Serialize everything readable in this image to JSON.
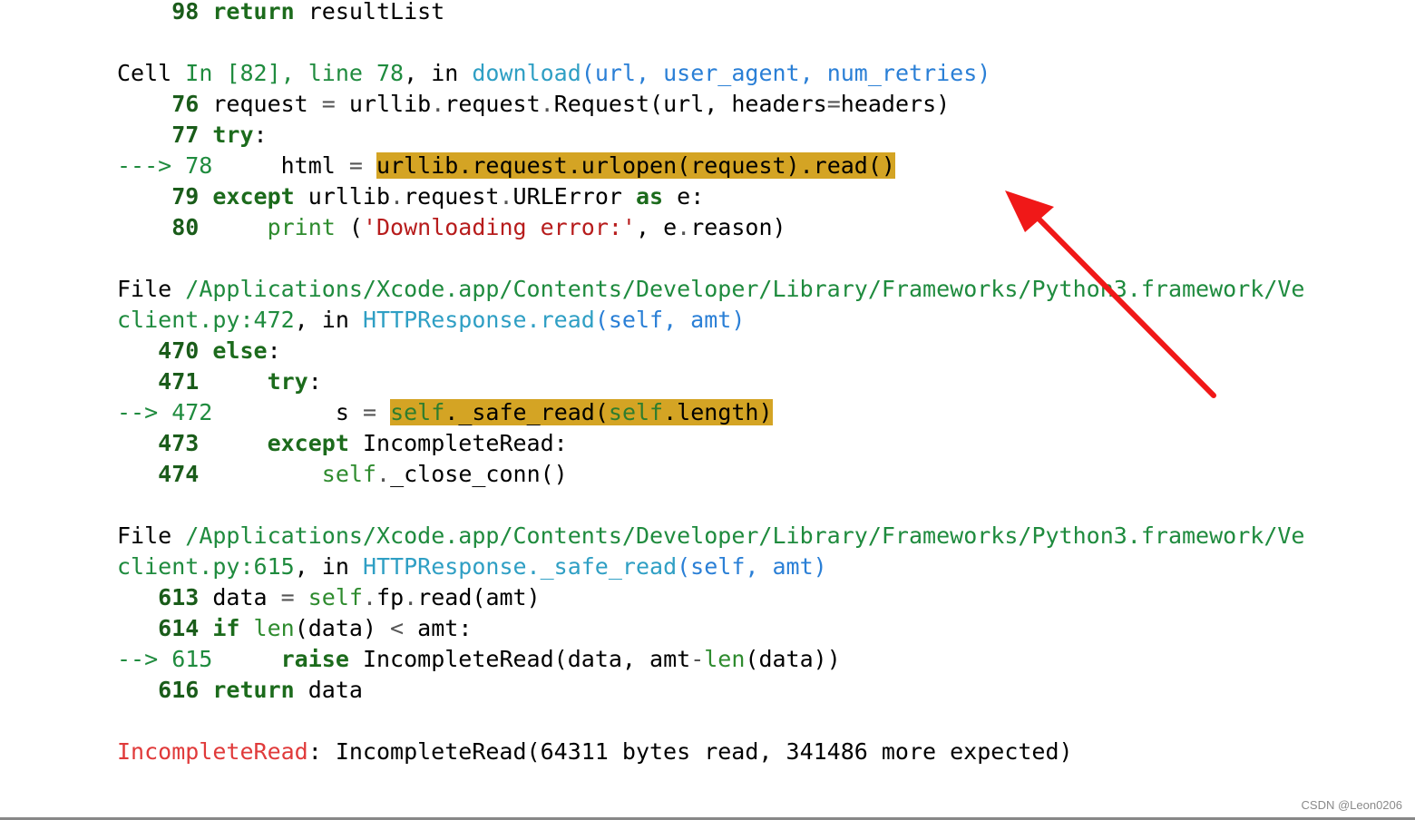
{
  "lines": [
    [
      {
        "t": "    98 ",
        "c": "num"
      },
      {
        "t": "return",
        "c": "kw"
      },
      {
        "t": " resultList",
        "c": "plain"
      }
    ],
    [],
    [
      {
        "t": "Cell ",
        "c": "plain"
      },
      {
        "t": "In [82], line 78",
        "c": "file"
      },
      {
        "t": ", in ",
        "c": "plain"
      },
      {
        "t": "download",
        "c": "func"
      },
      {
        "t": "(url, user_agent, num_retries)",
        "c": "arg"
      }
    ],
    [
      {
        "t": "    76 ",
        "c": "num"
      },
      {
        "t": "request ",
        "c": "plain"
      },
      {
        "t": "=",
        "c": "op"
      },
      {
        "t": " urllib",
        "c": "plain"
      },
      {
        "t": ".",
        "c": "op"
      },
      {
        "t": "request",
        "c": "plain"
      },
      {
        "t": ".",
        "c": "op"
      },
      {
        "t": "Request(url, headers",
        "c": "plain"
      },
      {
        "t": "=",
        "c": "op"
      },
      {
        "t": "headers)",
        "c": "plain"
      }
    ],
    [
      {
        "t": "    77 ",
        "c": "num"
      },
      {
        "t": "try",
        "c": "kw"
      },
      {
        "t": ":",
        "c": "plain"
      }
    ],
    [
      {
        "t": "---> 78     ",
        "c": "file"
      },
      {
        "t": "html ",
        "c": "plain"
      },
      {
        "t": "=",
        "c": "op"
      },
      {
        "t": " ",
        "c": "plain"
      },
      {
        "t": "urllib.request.urlopen(request).read()",
        "c": "hl"
      }
    ],
    [
      {
        "t": "    79 ",
        "c": "num"
      },
      {
        "t": "except",
        "c": "kw"
      },
      {
        "t": " urllib",
        "c": "plain"
      },
      {
        "t": ".",
        "c": "op"
      },
      {
        "t": "request",
        "c": "plain"
      },
      {
        "t": ".",
        "c": "op"
      },
      {
        "t": "URLError ",
        "c": "plain"
      },
      {
        "t": "as",
        "c": "kw"
      },
      {
        "t": " e:",
        "c": "plain"
      }
    ],
    [
      {
        "t": "    80     ",
        "c": "num"
      },
      {
        "t": "print",
        "c": "builtin"
      },
      {
        "t": " (",
        "c": "plain"
      },
      {
        "t": "'Downloading error:'",
        "c": "str"
      },
      {
        "t": ", e",
        "c": "plain"
      },
      {
        "t": ".",
        "c": "op"
      },
      {
        "t": "reason)",
        "c": "plain"
      }
    ],
    [],
    [
      {
        "t": "File ",
        "c": "plain"
      },
      {
        "t": "/Applications/Xcode.app/Contents/Developer/Library/Frameworks/Python3.framework/Ve",
        "c": "file"
      }
    ],
    [
      {
        "t": "client.py:472",
        "c": "file"
      },
      {
        "t": ", in ",
        "c": "plain"
      },
      {
        "t": "HTTPResponse.read",
        "c": "func"
      },
      {
        "t": "(self, amt)",
        "c": "arg"
      }
    ],
    [
      {
        "t": "   470 ",
        "c": "num"
      },
      {
        "t": "else",
        "c": "kw"
      },
      {
        "t": ":",
        "c": "plain"
      }
    ],
    [
      {
        "t": "   471     ",
        "c": "num"
      },
      {
        "t": "try",
        "c": "kw"
      },
      {
        "t": ":",
        "c": "plain"
      }
    ],
    [
      {
        "t": "--> 472         ",
        "c": "file"
      },
      {
        "t": "s ",
        "c": "plain"
      },
      {
        "t": "=",
        "c": "op"
      },
      {
        "t": " ",
        "c": "plain"
      },
      {
        "t": "self",
        "c": "hlg"
      },
      {
        "t": "._safe_read(",
        "c": "hl"
      },
      {
        "t": "self",
        "c": "hlg"
      },
      {
        "t": ".length)",
        "c": "hl"
      }
    ],
    [
      {
        "t": "   473     ",
        "c": "num"
      },
      {
        "t": "except",
        "c": "kw"
      },
      {
        "t": " IncompleteRead:",
        "c": "plain"
      }
    ],
    [
      {
        "t": "   474         ",
        "c": "num"
      },
      {
        "t": "self",
        "c": "builtin"
      },
      {
        "t": ".",
        "c": "op"
      },
      {
        "t": "_close_conn()",
        "c": "plain"
      }
    ],
    [],
    [
      {
        "t": "File ",
        "c": "plain"
      },
      {
        "t": "/Applications/Xcode.app/Contents/Developer/Library/Frameworks/Python3.framework/Ve",
        "c": "file"
      }
    ],
    [
      {
        "t": "client.py:615",
        "c": "file"
      },
      {
        "t": ", in ",
        "c": "plain"
      },
      {
        "t": "HTTPResponse._safe_read",
        "c": "func"
      },
      {
        "t": "(self, amt)",
        "c": "arg"
      }
    ],
    [
      {
        "t": "   613 ",
        "c": "num"
      },
      {
        "t": "data ",
        "c": "plain"
      },
      {
        "t": "=",
        "c": "op"
      },
      {
        "t": " ",
        "c": "plain"
      },
      {
        "t": "self",
        "c": "builtin"
      },
      {
        "t": ".",
        "c": "op"
      },
      {
        "t": "fp",
        "c": "plain"
      },
      {
        "t": ".",
        "c": "op"
      },
      {
        "t": "read(amt)",
        "c": "plain"
      }
    ],
    [
      {
        "t": "   614 ",
        "c": "num"
      },
      {
        "t": "if",
        "c": "kw"
      },
      {
        "t": " ",
        "c": "plain"
      },
      {
        "t": "len",
        "c": "builtin"
      },
      {
        "t": "(data) ",
        "c": "plain"
      },
      {
        "t": "<",
        "c": "op"
      },
      {
        "t": " amt:",
        "c": "plain"
      }
    ],
    [
      {
        "t": "--> 615     ",
        "c": "file"
      },
      {
        "t": "raise",
        "c": "kw"
      },
      {
        "t": " IncompleteRead(data, amt",
        "c": "plain"
      },
      {
        "t": "-",
        "c": "op"
      },
      {
        "t": "len",
        "c": "builtin"
      },
      {
        "t": "(data))",
        "c": "plain"
      }
    ],
    [
      {
        "t": "   616 ",
        "c": "num"
      },
      {
        "t": "return",
        "c": "kw"
      },
      {
        "t": " data",
        "c": "plain"
      }
    ],
    [],
    [
      {
        "t": "IncompleteRead",
        "c": "ex"
      },
      {
        "t": ": IncompleteRead(64311 bytes read, 341486 more expected)",
        "c": "plain"
      }
    ]
  ],
  "annotation": {
    "arrow_color": "#f01818"
  },
  "watermark": "CSDN @Leon0206"
}
